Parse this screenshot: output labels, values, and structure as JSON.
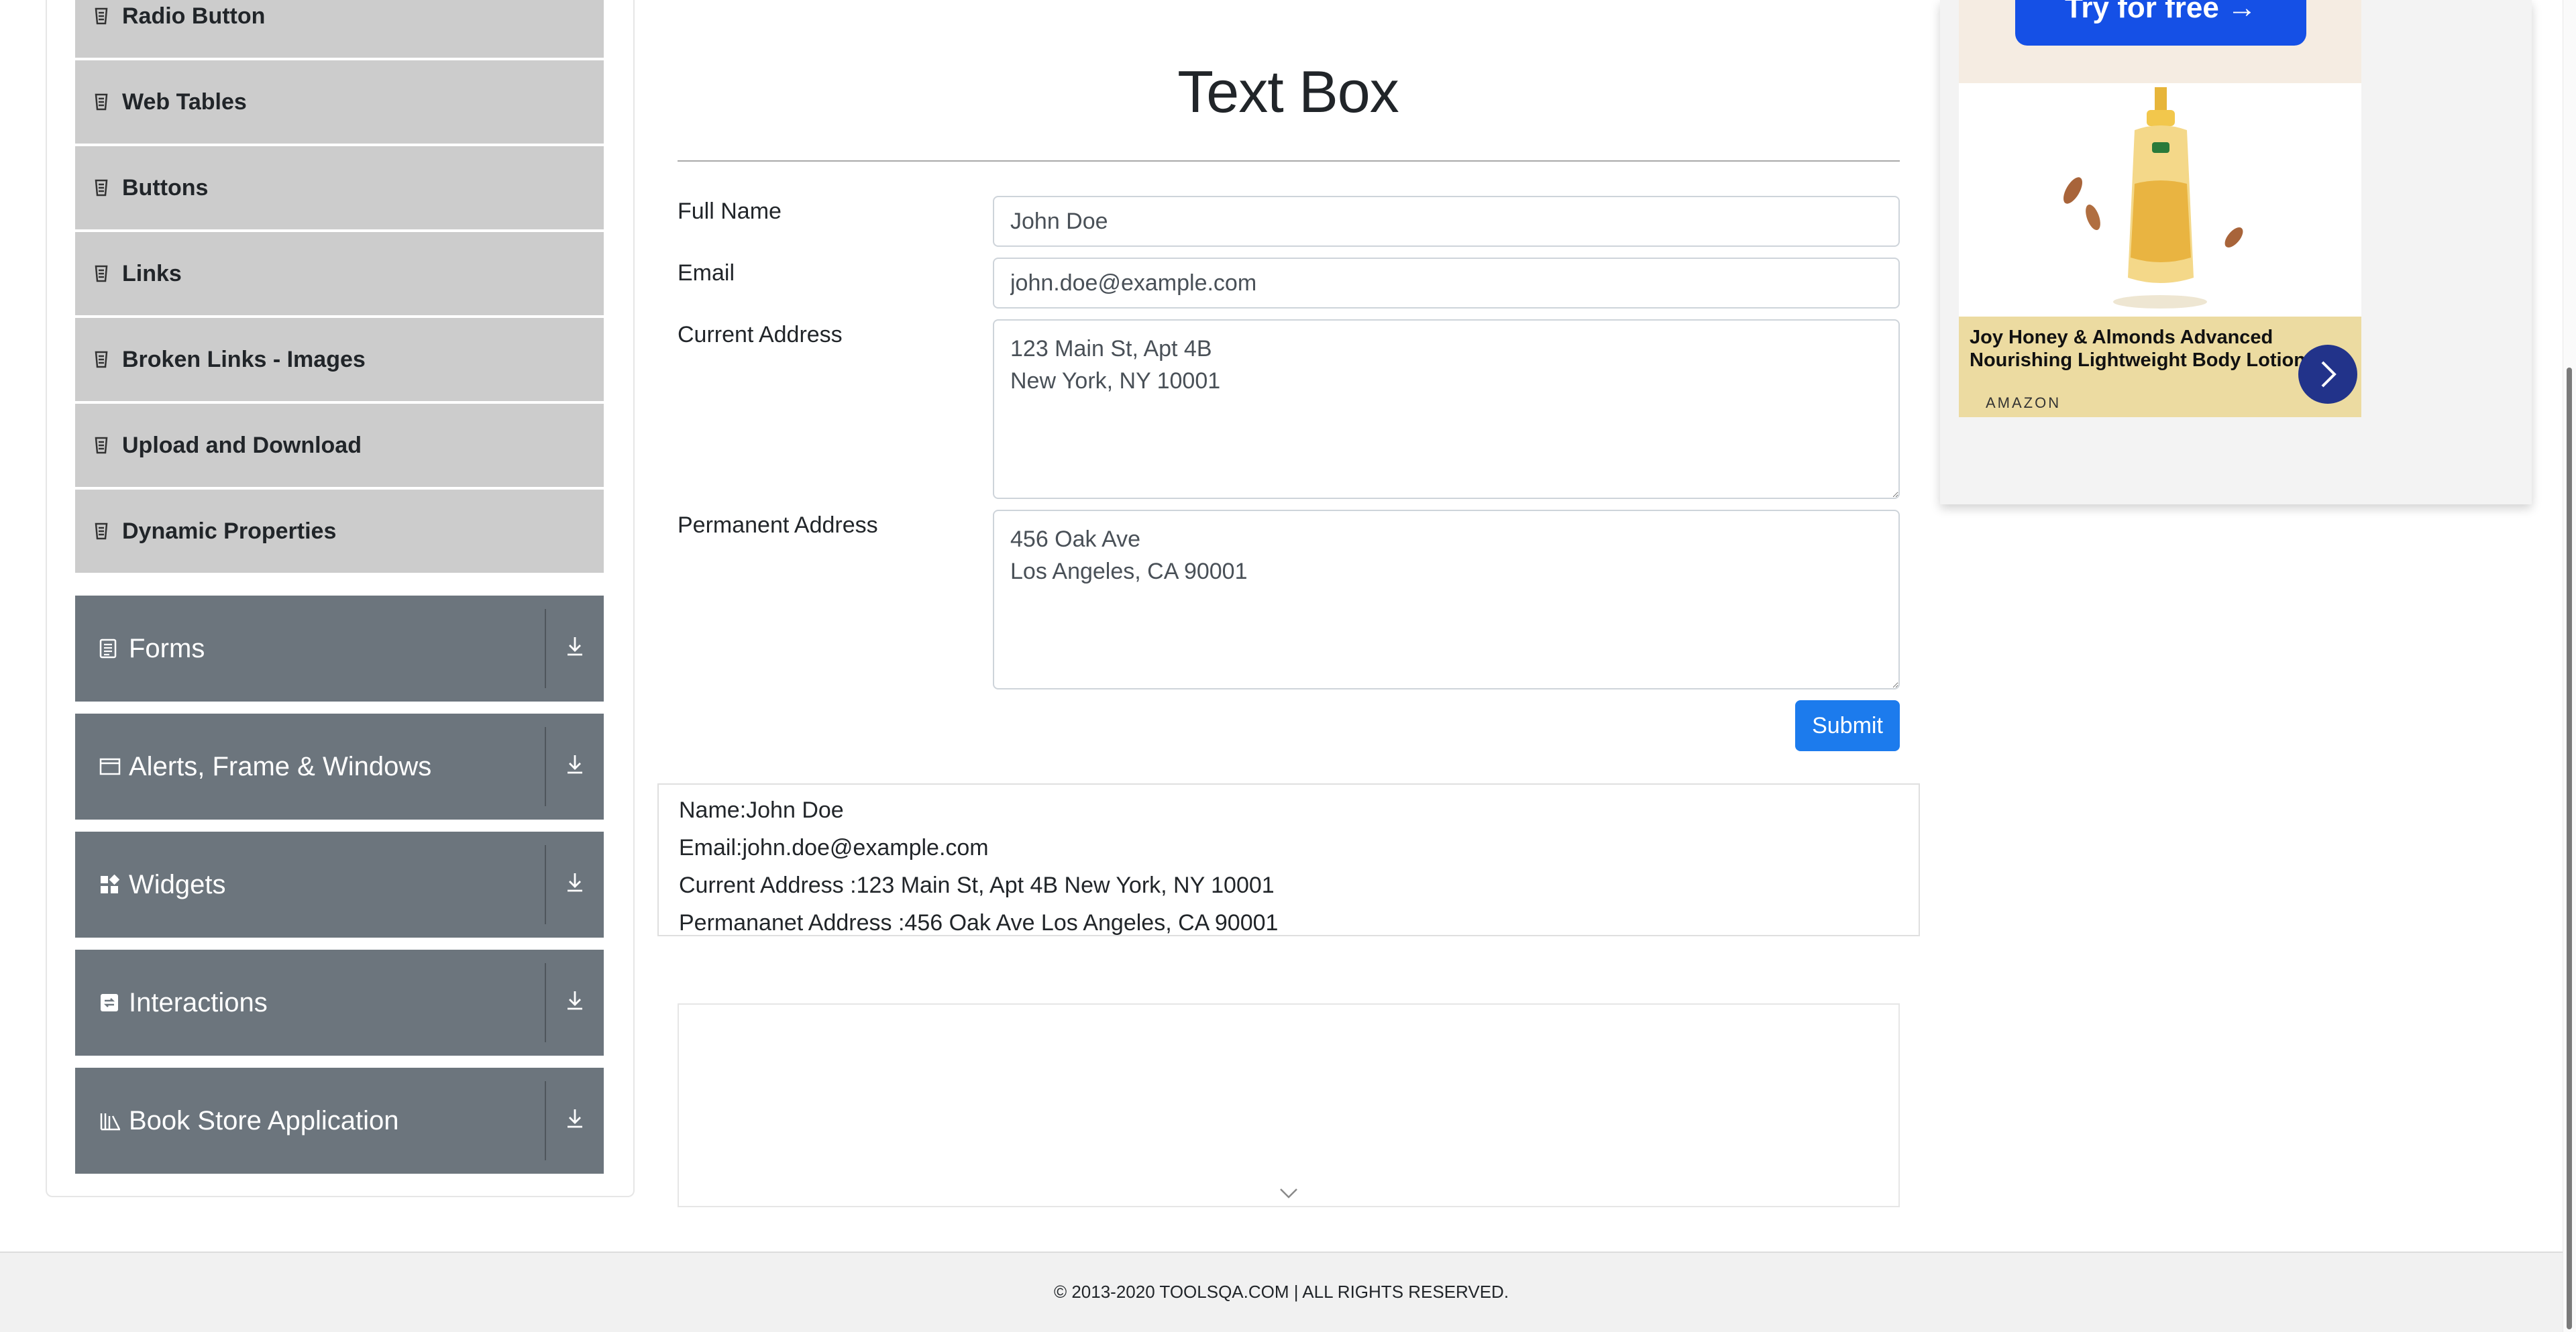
{
  "sidebar": {
    "elements_items": [
      {
        "label": "Radio Button",
        "icon": "list-icon"
      },
      {
        "label": "Web Tables",
        "icon": "list-icon"
      },
      {
        "label": "Buttons",
        "icon": "list-icon"
      },
      {
        "label": "Links",
        "icon": "list-icon"
      },
      {
        "label": "Broken Links - Images",
        "icon": "list-icon"
      },
      {
        "label": "Upload and Download",
        "icon": "list-icon"
      },
      {
        "label": "Dynamic Properties",
        "icon": "list-icon"
      }
    ],
    "groups": [
      {
        "label": "Forms",
        "icon": "document-icon"
      },
      {
        "label": "Alerts, Frame & Windows",
        "icon": "window-icon"
      },
      {
        "label": "Widgets",
        "icon": "widgets-icon"
      },
      {
        "label": "Interactions",
        "icon": "interactions-icon"
      },
      {
        "label": "Book Store Application",
        "icon": "books-icon"
      }
    ]
  },
  "main": {
    "title": "Text Box",
    "form": {
      "full_name_label": "Full Name",
      "full_name_value": "John Doe",
      "email_label": "Email",
      "email_value": "john.doe@example.com",
      "current_address_label": "Current Address",
      "current_address_value": "123 Main St, Apt 4B\nNew York, NY 10001",
      "permanent_address_label": "Permanent Address",
      "permanent_address_value": "456 Oak Ave\nLos Angeles, CA 90001",
      "submit_label": "Submit"
    },
    "output": {
      "name": "Name:John Doe",
      "email": "Email:john.doe@example.com",
      "current_address": "Current Address :123 Main St, Apt 4B New York, NY 10001",
      "permanent_address": "Permananet Address :456 Oak Ave Los Angeles, CA 90001"
    }
  },
  "ad": {
    "cta": "Try for free →",
    "title": "Joy Honey & Almonds Advanced Nourishing Lightweight Body Lotion",
    "brand": "AMAZON"
  },
  "footer": {
    "text": "© 2013-2020 TOOLSQA.COM | ALL RIGHTS RESERVED."
  },
  "colors": {
    "submit": "#1c7bed",
    "group_header": "#6c757d",
    "menu_item": "#cccccc",
    "ad_cta": "#1550e6"
  }
}
